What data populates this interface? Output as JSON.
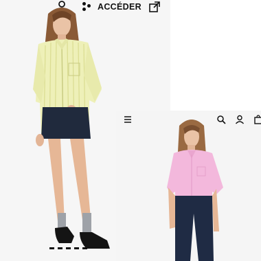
{
  "header": {
    "access_label": "ACCÉDER"
  },
  "icons": {
    "access": "dots-icon",
    "external": "external-link-icon",
    "menu": "hamburger-menu-icon",
    "search": "search-icon",
    "account": "user-icon",
    "bag": "shopping-bag-icon"
  },
  "products": [
    {
      "shirt_color": "#eef0b8",
      "stripe_color": "#d9dc8f"
    },
    {
      "shirt_color": "#f3b8dc"
    }
  ],
  "carousel": {
    "count": 5,
    "active": 2
  }
}
